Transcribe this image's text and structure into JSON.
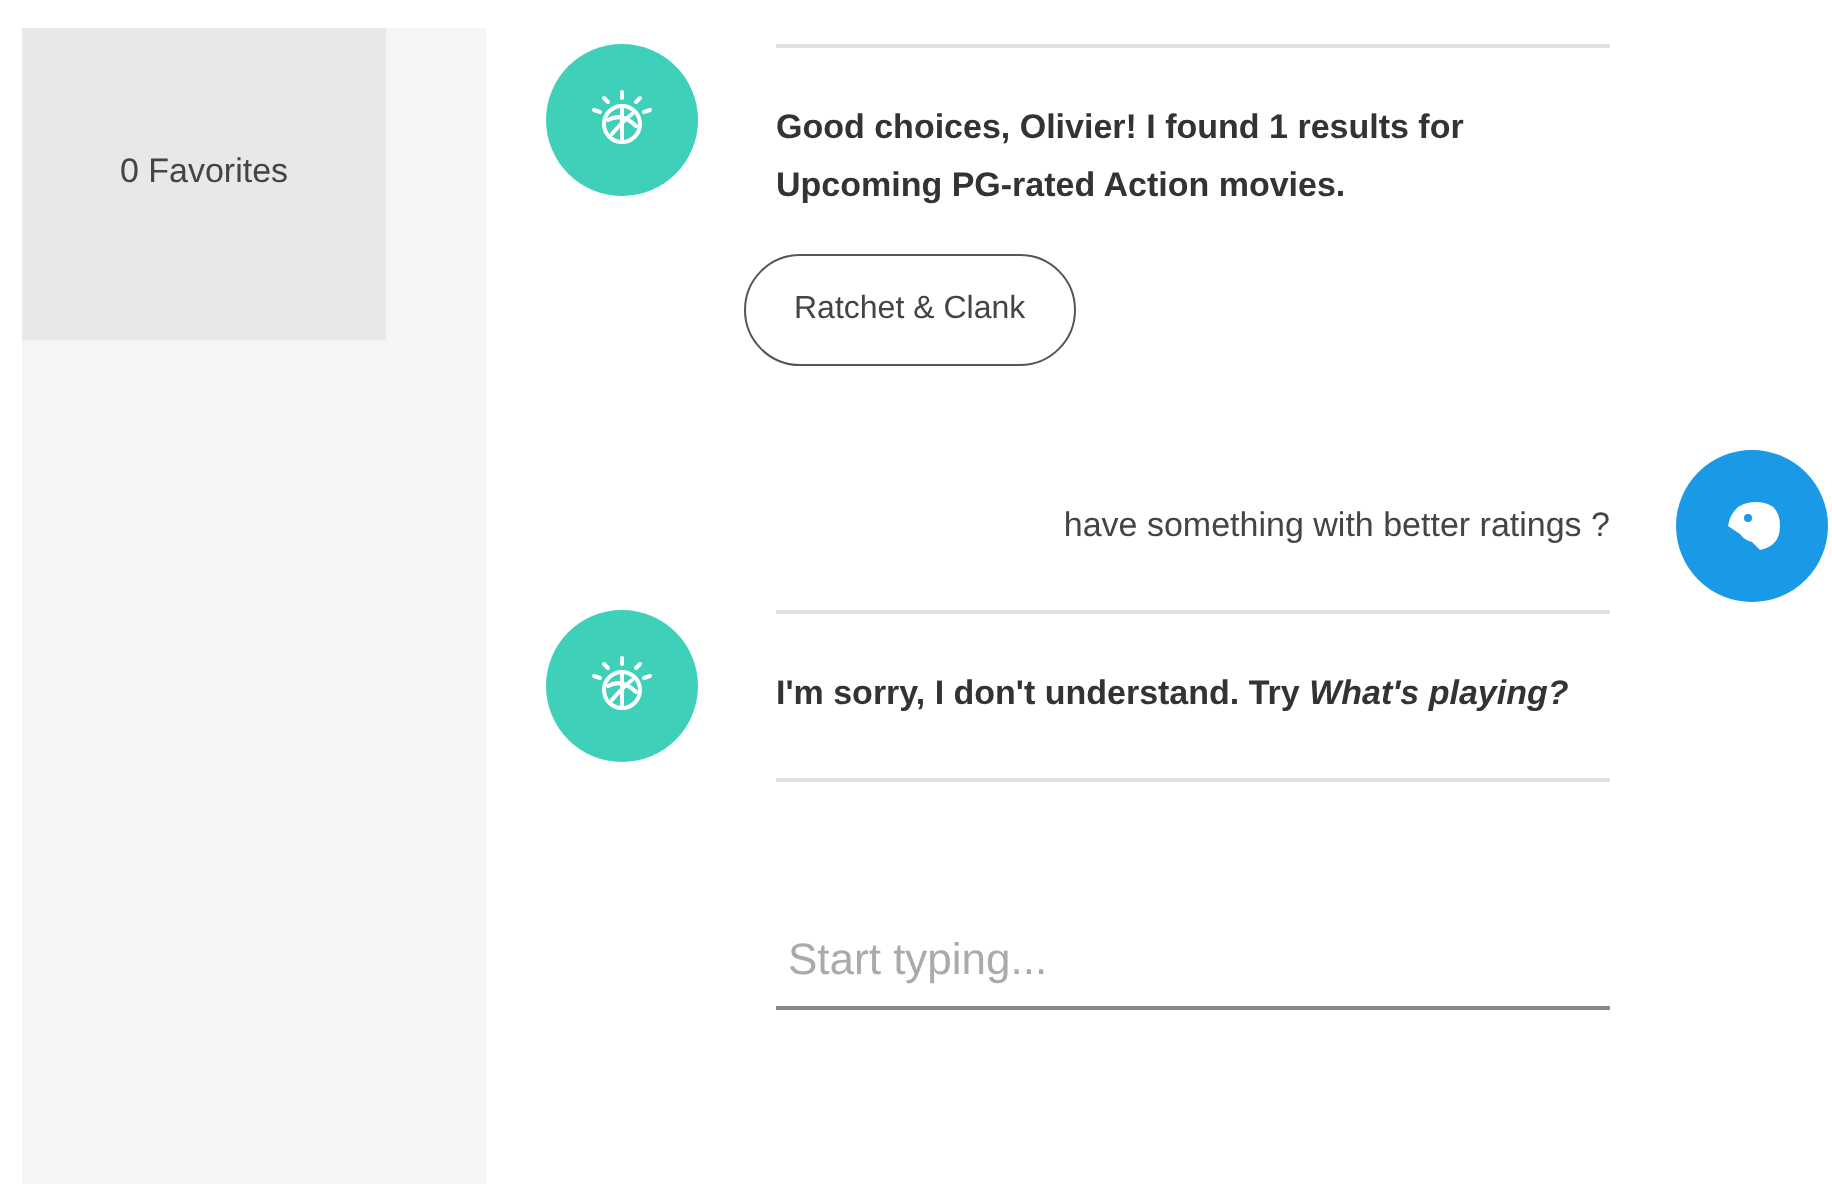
{
  "sidebar": {
    "favorites": "0 Favorites"
  },
  "messages": [
    {
      "kind": "bot",
      "text": "Good choices, Olivier! I found 1 results for Upcoming PG-rated Action movies.",
      "chips": [
        "Ratchet & Clank"
      ]
    },
    {
      "kind": "user",
      "text": "have something with better ratings ?"
    },
    {
      "kind": "bot",
      "text": "I'm sorry, I don't understand. Try *What's playing?*"
    }
  ],
  "input": {
    "placeholder": "Start typing..."
  }
}
